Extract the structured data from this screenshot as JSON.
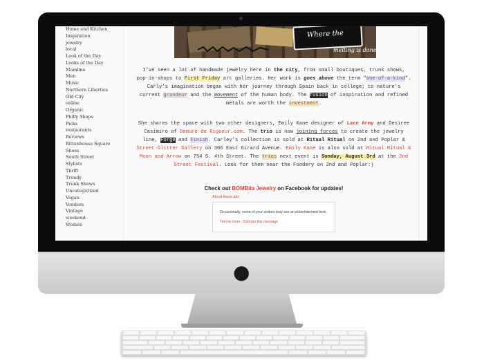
{
  "sidebar": {
    "items": [
      "Home and Kitchen",
      "Inspiration",
      "jewelry",
      "local",
      "Look of the Day",
      "Looks of the Day",
      "Mainline",
      "Men",
      "Music",
      "Northern Liberties",
      "Old City",
      "online",
      "Organic",
      "Philly Shops",
      "Picks",
      "restaurants",
      "Reviews",
      "Rittenhouse Square",
      "Shoes",
      "South Street",
      "Stylists",
      "Thrift",
      "Trendy",
      "Trunk Shows",
      "Uncategorized",
      "Vegan",
      "Vendors",
      "Vintage",
      "weekend",
      "Women"
    ]
  },
  "banner": {
    "slogan_line1": "Where the",
    "slogan_line2": "melting is done"
  },
  "p1": {
    "t1": "I've seen ",
    "t2": "a lot",
    "t3": " of handmade jewelry here in ",
    "t4": "the city",
    "t5": ",  from small boutiques, trunk shows, pop-in-shops to ",
    "t6": "First Friday",
    "t7": " art galleries.  Her work is ",
    "t8": "goes above",
    "t9": " the term \"",
    "t10": "one-of-a-kind",
    "t11": "\". Carly's imagination began with her journey through Spain back in college; to nature's current ",
    "t12": "grandeur",
    "t13": " and the ",
    "t14": "movement",
    "t15": " of the human body.  The ",
    "t16": "fusion",
    "t17": " of inspiration and refined metals are worth the ",
    "t18": "investment",
    "t19": "."
  },
  "p2": {
    "t1": "She shares the space with two other designers, Emily Kane designer of ",
    "t2": "Lace Army",
    "t3": " and Desiree Casimiro of ",
    "t4": "Demure de Rigueur.com",
    "t5": ".  The ",
    "t6": "trio",
    "t7": " is now ",
    "t8": "joining forces",
    "t9": " to create the jewelry line, ",
    "t10": "Forge",
    "t11": " and ",
    "t12": "Finish",
    "t13": ". Carley's collection is sold at ",
    "t14": "Ritual Ritual",
    "t15": " on 2nd and Poplar & ",
    "t16": "Street Glitter Gallery",
    "t17": " on 306 East Girard Avenue. ",
    "t18": "Emily Kane",
    "t19": " is also sold at ",
    "t20": "Ritual Ritual & Moon and Arrow",
    "t21": " on 754 S. 4th Street.  The ",
    "t22": "trios",
    "t23": " next event is ",
    "t24": "Sunday, August 3rd",
    "t25": " at the ",
    "t26": "2nd Street Festival",
    "t27": ".  Look for them near the Foodery on 2nd and Poplar:)"
  },
  "facebook": {
    "pre": "Check out ",
    "link": "BOMBita Jewelry",
    "post": " on Facebook for updates!"
  },
  "ads": {
    "about": "About these ads",
    "message": "Occasionally, some of your visitors may see an advertisement here.",
    "tell_more": "Tell me more",
    "separator": "|",
    "dismiss": "Dismiss this message"
  },
  "colors": {
    "accent": "#e4412f",
    "highlight_yellow": "#fdf2a6",
    "highlight_purple": "#e3e0f5"
  }
}
